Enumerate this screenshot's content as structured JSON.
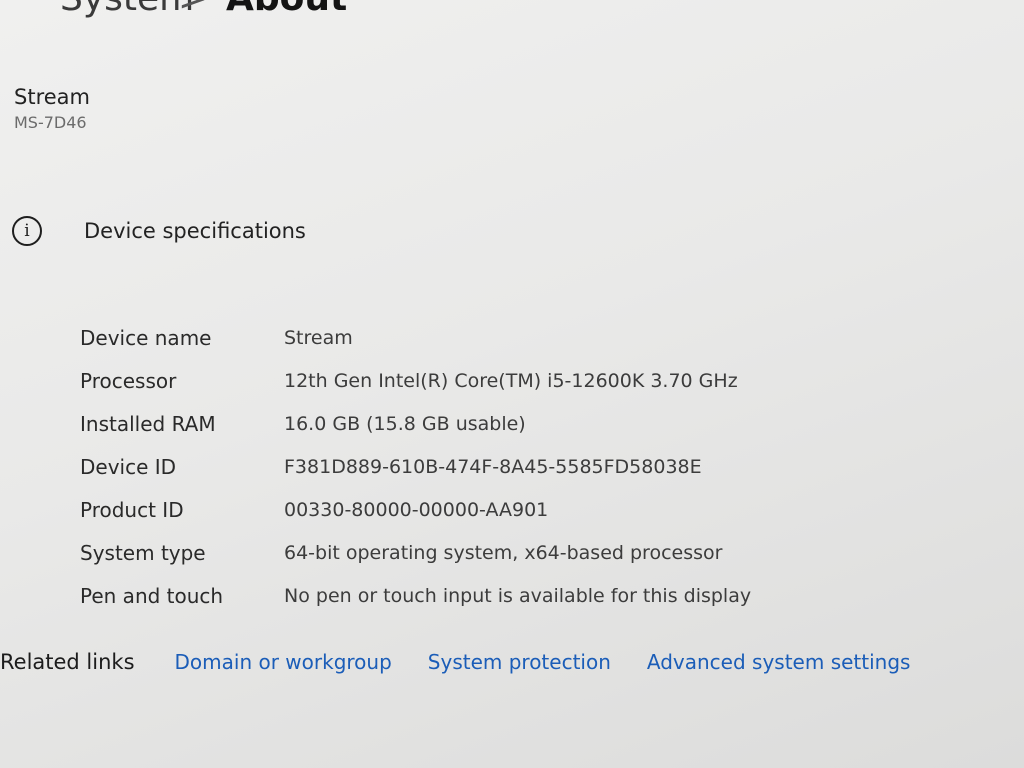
{
  "breadcrumb": {
    "parent": "System",
    "separator": ">",
    "current": "About"
  },
  "device": {
    "name": "Stream",
    "model": "MS-7D46"
  },
  "specs": {
    "icon": "info-icon",
    "title": "Device specifications",
    "rows": [
      {
        "label": "Device name",
        "value": "Stream"
      },
      {
        "label": "Processor",
        "value": "12th Gen Intel(R) Core(TM) i5-12600K   3.70 GHz"
      },
      {
        "label": "Installed RAM",
        "value": "16.0 GB (15.8 GB usable)"
      },
      {
        "label": "Device ID",
        "value": "F381D889-610B-474F-8A45-5585FD58038E"
      },
      {
        "label": "Product ID",
        "value": "00330-80000-00000-AA901"
      },
      {
        "label": "System type",
        "value": "64-bit operating system, x64-based processor"
      },
      {
        "label": "Pen and touch",
        "value": "No pen or touch input is available for this display"
      }
    ]
  },
  "related_links": {
    "label": "Related links",
    "links": [
      "Domain or workgroup",
      "System protection",
      "Advanced system settings"
    ]
  },
  "colors": {
    "link": "#1b5db8",
    "background": "#ececeb",
    "text": "#1f1f1f"
  }
}
